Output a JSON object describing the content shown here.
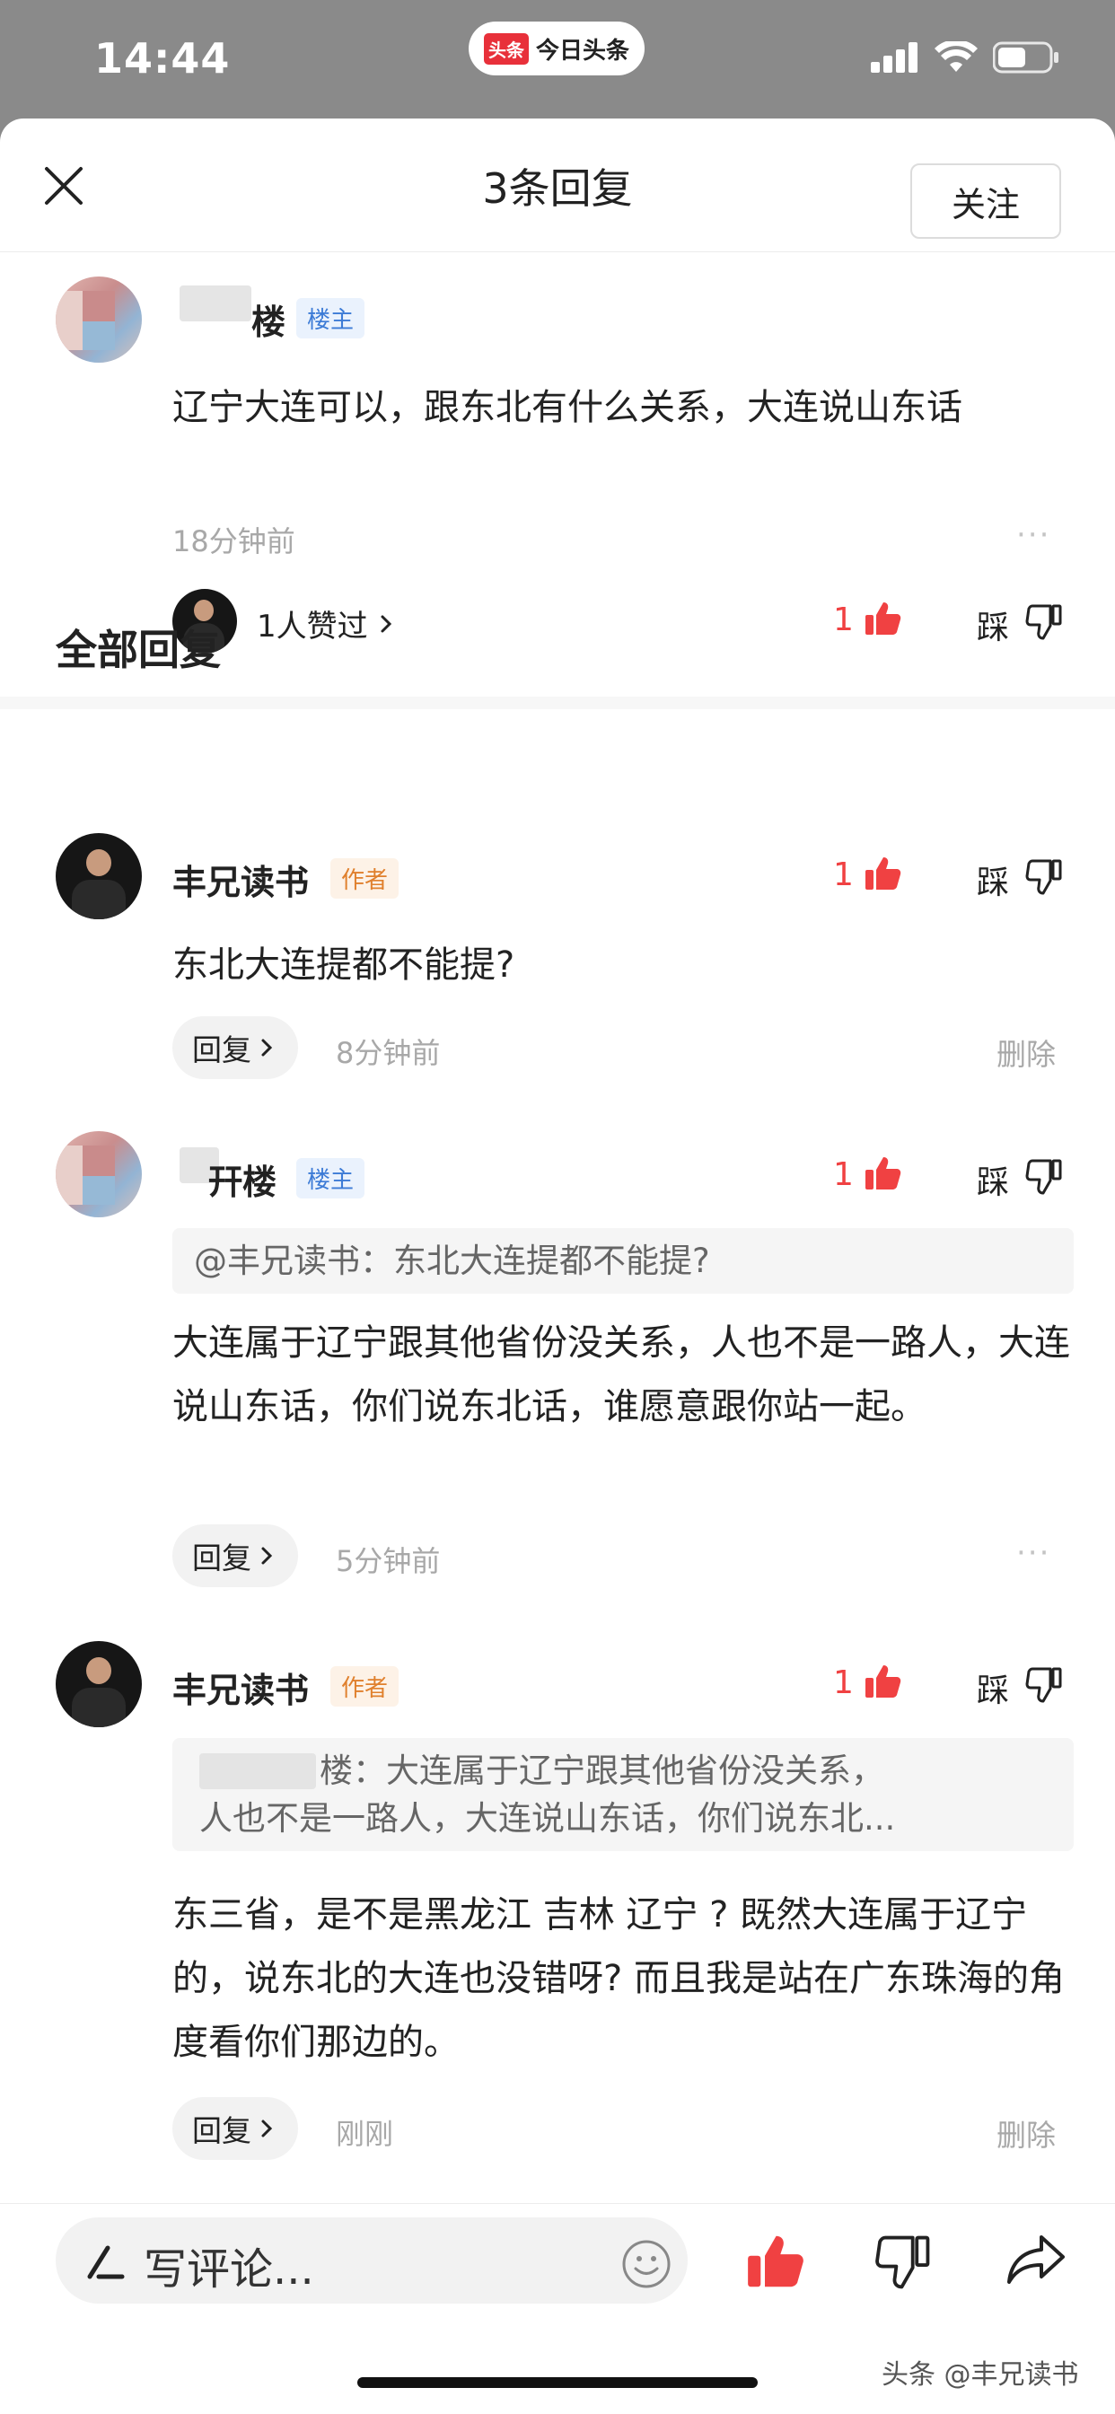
{
  "status_bar": {
    "time": "14:44",
    "app_logo": "头条",
    "app_name": "今日头条"
  },
  "header": {
    "title": "3条回复"
  },
  "main_comment": {
    "username_suffix": "楼",
    "badge": "楼主",
    "follow_label": "关注",
    "text": "辽宁大连可以，跟东北有什么关系，大连说山东话",
    "time": "18分钟前",
    "liked_by": "1人赞过",
    "like_count": "1",
    "dislike_label": "踩"
  },
  "section_title": "全部回复",
  "replies": [
    {
      "username": "丰兄读书",
      "badge": "作者",
      "text": "东北大连提都不能提?",
      "like_count": "1",
      "dislike_label": "踩",
      "reply_label": "回复",
      "time": "8分钟前",
      "delete_label": "删除"
    },
    {
      "username_suffix": "幵楼",
      "badge": "楼主",
      "quote": "@丰兄读书：东北大连提都不能提?",
      "text": "大连属于辽宁跟其他省份没关系，人也不是一路人，大连说山东话，你们说东北话，谁愿意跟你站一起。",
      "like_count": "1",
      "dislike_label": "踩",
      "reply_label": "回复",
      "time": "5分钟前"
    },
    {
      "username": "丰兄读书",
      "badge": "作者",
      "quote_line1": "楼：大连属于辽宁跟其他省份没关系，",
      "quote_line2": "人也不是一路人，大连说山东话，你们说东北...",
      "text": "东三省，是不是黑龙江 吉林 辽宁 ? 既然大连属于辽宁的，说东北的大连也没错呀? 而且我是站在广东珠海的角度看你们那边的。",
      "like_count": "1",
      "dislike_label": "踩",
      "reply_label": "回复",
      "time": "刚刚",
      "delete_label": "删除"
    }
  ],
  "bottom_bar": {
    "comment_placeholder": "写评论...",
    "watermark": "头条 @丰兄读书"
  },
  "icons": [
    "close-icon",
    "thumb-up-icon",
    "thumb-down-icon",
    "chevron-right-icon",
    "edit-icon",
    "emoji-icon",
    "share-icon",
    "signal-icon",
    "wifi-icon",
    "battery-icon",
    "more-icon"
  ],
  "colors": {
    "accent_red": "#f04142",
    "host_badge": "#3c7bd6",
    "author_badge": "#e0802d"
  }
}
